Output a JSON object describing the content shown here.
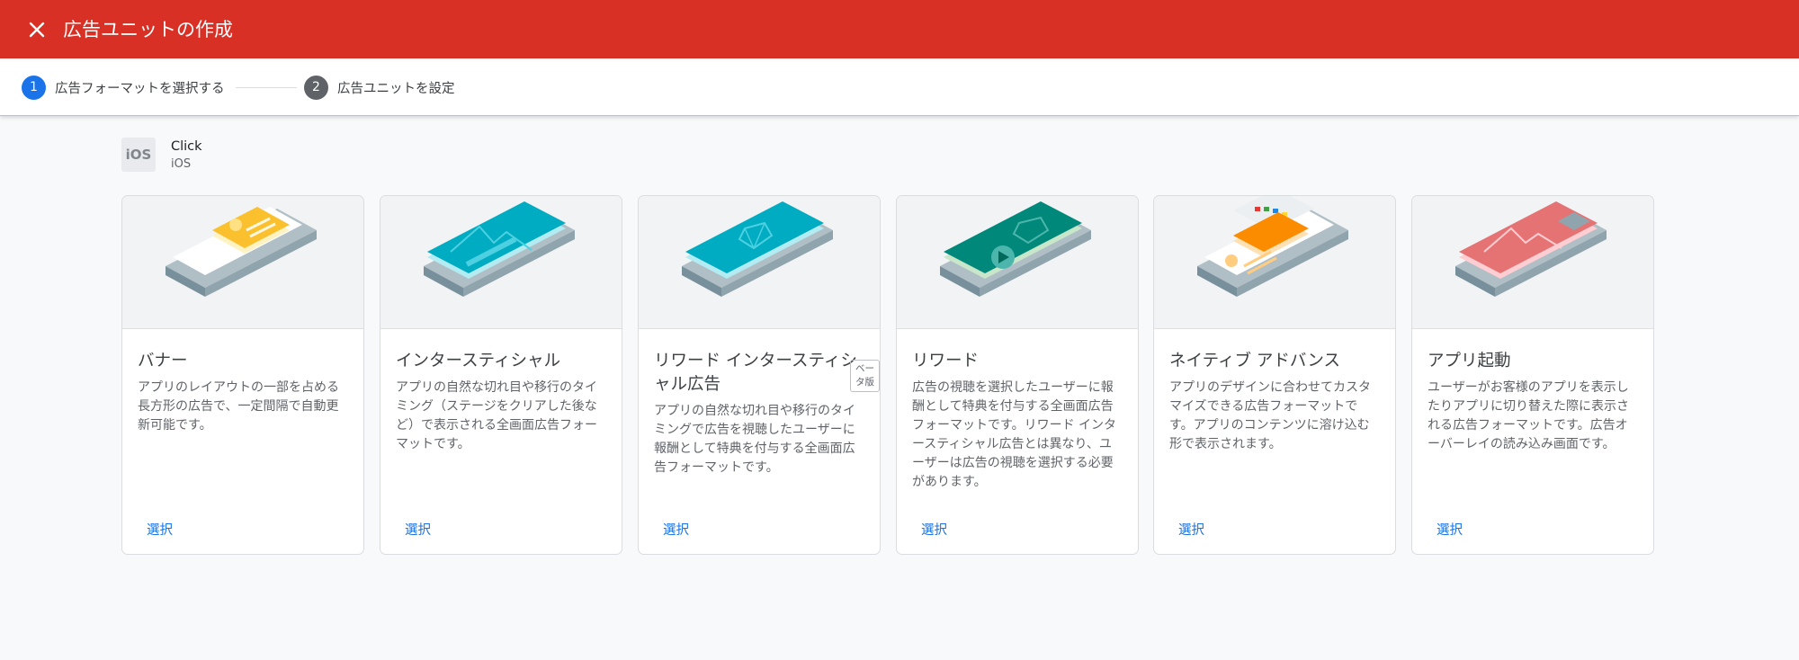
{
  "header": {
    "title": "広告ユニットの作成",
    "close_icon": "close-icon",
    "background_color": "#d93025"
  },
  "stepper": {
    "steps": [
      {
        "number": "1",
        "label": "広告フォーマットを選択する",
        "state": "active",
        "color": "#1a73e8"
      },
      {
        "number": "2",
        "label": "広告ユニットを設定",
        "state": "inactive",
        "color": "#5f6368"
      }
    ]
  },
  "app": {
    "icon_text": "iOS",
    "name": "Click",
    "platform": "iOS"
  },
  "formats": [
    {
      "title": "バナー",
      "description": "アプリのレイアウトの一部を占める長方形の広告で、一定間隔で自動更新可能です。",
      "select_label": "選択",
      "beta_label": "",
      "illustration": "banner-illustration"
    },
    {
      "title": "インタースティシャル",
      "description": "アプリの自然な切れ目や移行のタイミング（ステージをクリアした後など）で表示される全画面広告フォーマットです。",
      "select_label": "選択",
      "beta_label": "",
      "illustration": "interstitial-illustration"
    },
    {
      "title": "リワード インタースティシャル広告",
      "description": "アプリの自然な切れ目や移行のタイミングで広告を視聴したユーザーに報酬として特典を付与する全画面広告フォーマットです。",
      "select_label": "選択",
      "beta_label": "ベータ版",
      "illustration": "rewarded-interstitial-illustration"
    },
    {
      "title": "リワード",
      "description": "広告の視聴を選択したユーザーに報酬として特典を付与する全画面広告フォーマットです。リワード インタースティシャル広告とは異なり、ユーザーは広告の視聴を選択する必要があります。",
      "select_label": "選択",
      "beta_label": "",
      "illustration": "rewarded-illustration"
    },
    {
      "title": "ネイティブ アドバンス",
      "description": "アプリのデザインに合わせてカスタマイズできる広告フォーマットです。アプリのコンテンツに溶け込む形で表示されます。",
      "select_label": "選択",
      "beta_label": "",
      "illustration": "native-advanced-illustration"
    },
    {
      "title": "アプリ起動",
      "description": "ユーザーがお客様のアプリを表示したりアプリに切り替えた際に表示される広告フォーマットです。広告オーバーレイの読み込み画面です。",
      "select_label": "選択",
      "beta_label": "",
      "illustration": "app-open-illustration"
    }
  ]
}
